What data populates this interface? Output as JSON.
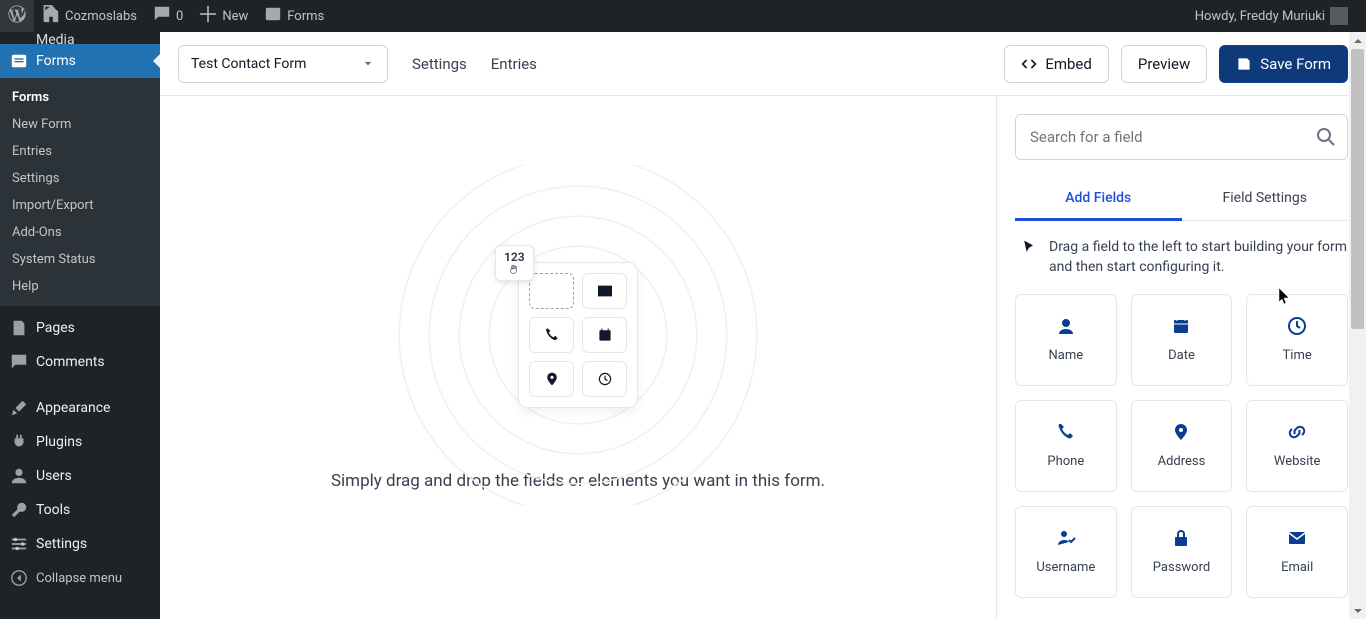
{
  "adminbar": {
    "site_name": "Cozmoslabs",
    "comments_count": "0",
    "new_label": "New",
    "forms_label": "Forms",
    "howdy": "Howdy, Freddy Muriuki"
  },
  "sidebar": {
    "truncated_label": "Media",
    "active_label": "Forms",
    "submenu": {
      "forms": "Forms",
      "new_form": "New Form",
      "entries": "Entries",
      "settings": "Settings",
      "import_export": "Import/Export",
      "addons": "Add-Ons",
      "system_status": "System Status",
      "help": "Help"
    },
    "pages": "Pages",
    "comments": "Comments",
    "appearance": "Appearance",
    "plugins": "Plugins",
    "users": "Users",
    "tools": "Tools",
    "settings": "Settings",
    "collapse": "Collapse menu"
  },
  "toolbar": {
    "form_name": "Test Contact Form",
    "settings_link": "Settings",
    "entries_link": "Entries",
    "embed_label": "Embed",
    "preview_label": "Preview",
    "save_label": "Save Form"
  },
  "canvas": {
    "chip_text": "123",
    "instruction": "Simply drag and drop the fields or elements you want in this form."
  },
  "panel": {
    "search_placeholder": "Search for a field",
    "tab_add": "Add Fields",
    "tab_settings": "Field Settings",
    "hint": "Drag a field to the left to start building your form and then start configuring it.",
    "fields": {
      "name": "Name",
      "date": "Date",
      "time": "Time",
      "phone": "Phone",
      "address": "Address",
      "website": "Website",
      "username": "Username",
      "password": "Password",
      "email": "Email"
    }
  }
}
